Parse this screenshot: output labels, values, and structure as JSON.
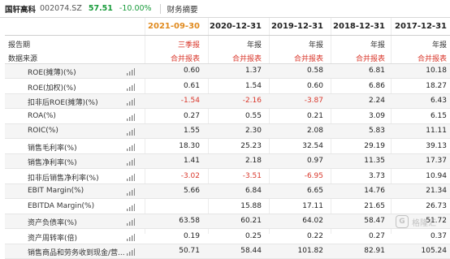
{
  "topbar": {
    "stock_name": "国轩高科",
    "stock_code": "002074.SZ",
    "price": "57.51",
    "change": "-10.00%",
    "section": "财务摘要"
  },
  "columns": [
    {
      "year": "2021-09-30",
      "report": "三季报",
      "source": "合并报表",
      "current": true
    },
    {
      "year": "2020-12-31",
      "report": "年报",
      "source": "合并报表",
      "current": false
    },
    {
      "year": "2019-12-31",
      "report": "年报",
      "source": "合并报表",
      "current": false
    },
    {
      "year": "2018-12-31",
      "report": "年报",
      "source": "合并报表",
      "current": false
    },
    {
      "year": "2017-12-31",
      "report": "年报",
      "source": "合并报表",
      "current": false
    }
  ],
  "header_labels": {
    "period": "报告期",
    "source": "数据来源"
  },
  "rows": [
    {
      "label": "ROE(摊薄)(%)",
      "values": [
        "0.60",
        "1.37",
        "0.58",
        "6.81",
        "10.18"
      ]
    },
    {
      "label": "ROE(加权)(%)",
      "values": [
        "0.61",
        "1.54",
        "0.60",
        "6.86",
        "18.27"
      ]
    },
    {
      "label": "扣非后ROE(摊薄)(%)",
      "values": [
        "-1.54",
        "-2.16",
        "-3.87",
        "2.24",
        "6.43"
      ]
    },
    {
      "label": "ROA(%)",
      "values": [
        "0.27",
        "0.55",
        "0.21",
        "3.09",
        "6.15"
      ]
    },
    {
      "label": "ROIC(%)",
      "values": [
        "1.55",
        "2.30",
        "2.08",
        "5.83",
        "11.11"
      ]
    },
    {
      "label": "销售毛利率(%)",
      "values": [
        "18.30",
        "25.23",
        "32.54",
        "29.19",
        "39.13"
      ]
    },
    {
      "label": "销售净利率(%)",
      "values": [
        "1.41",
        "2.18",
        "0.97",
        "11.35",
        "17.37"
      ]
    },
    {
      "label": "扣非后销售净利率(%)",
      "values": [
        "-3.02",
        "-3.51",
        "-6.95",
        "3.73",
        "10.94"
      ]
    },
    {
      "label": "EBIT Margin(%)",
      "values": [
        "5.66",
        "6.84",
        "6.65",
        "14.76",
        "21.34"
      ]
    },
    {
      "label": "EBITDA Margin(%)",
      "values": [
        "",
        "15.88",
        "17.11",
        "21.65",
        "26.73"
      ]
    },
    {
      "label": "资产负债率(%)",
      "values": [
        "63.58",
        "60.21",
        "64.02",
        "58.47",
        "51.72"
      ]
    },
    {
      "label": "资产周转率(倍)",
      "values": [
        "0.19",
        "0.25",
        "0.22",
        "0.27",
        "0.37"
      ]
    },
    {
      "label": "销售商品和劳务收到现金/营...",
      "values": [
        "50.71",
        "58.44",
        "101.82",
        "82.91",
        "105.24"
      ]
    }
  ],
  "watermark": {
    "logo_char": "G",
    "text": "格隆汇"
  },
  "colors": {
    "negative": "#d9372b",
    "current_period": "#e08a1e",
    "price_down": "#1a9c3c"
  }
}
